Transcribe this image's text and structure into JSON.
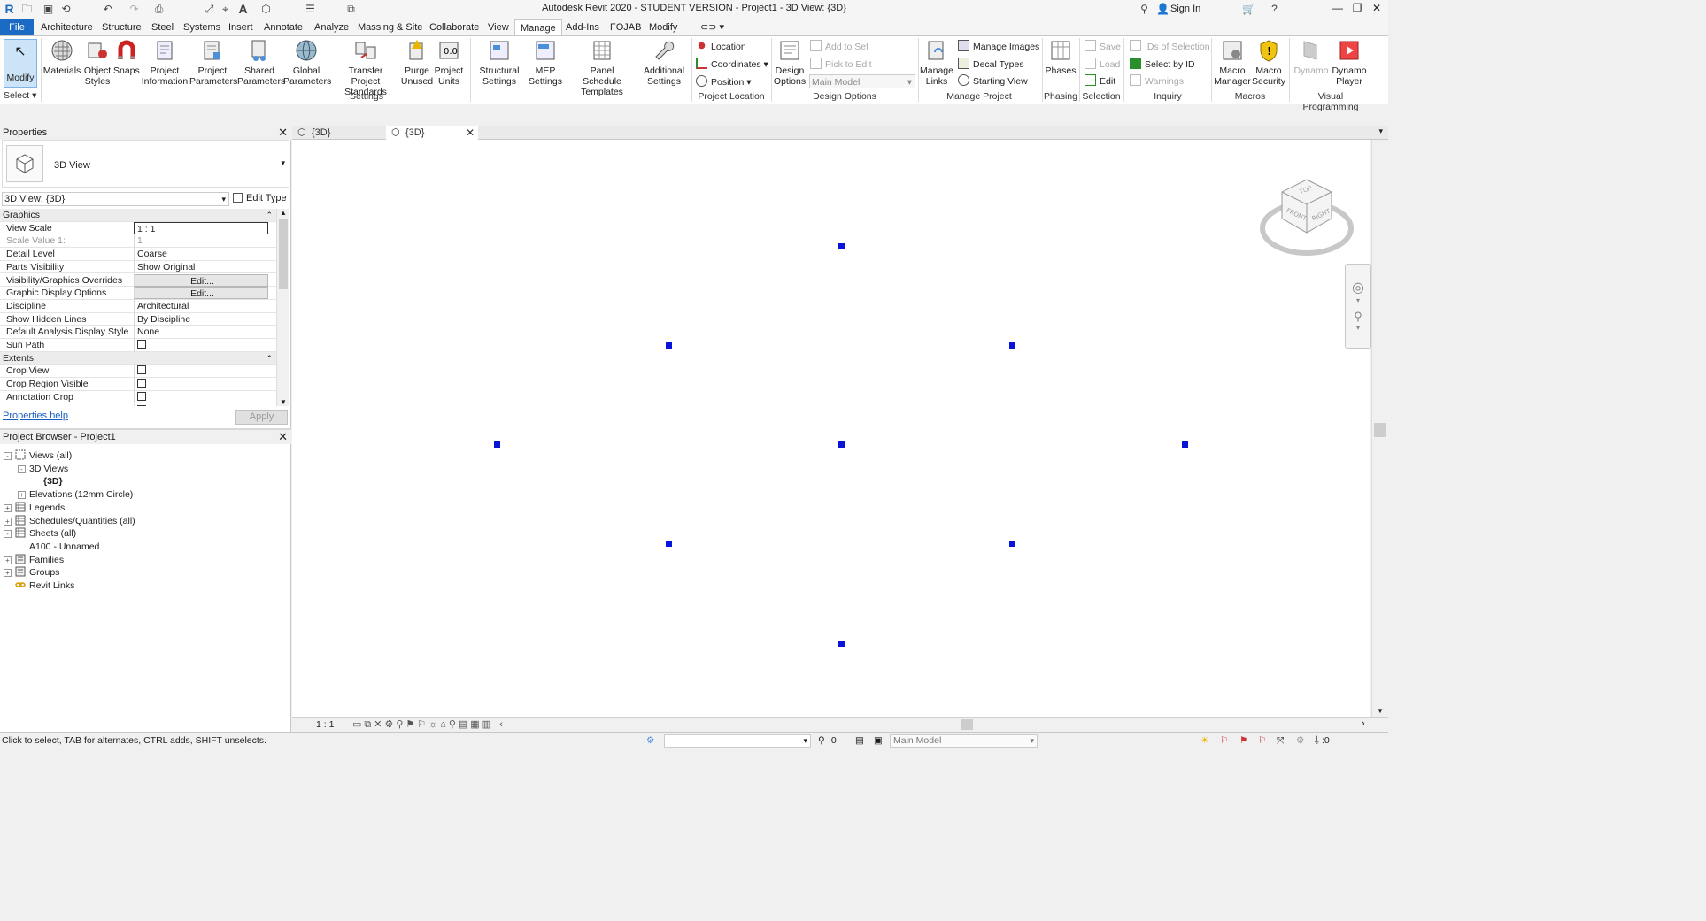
{
  "window": {
    "title": "Autodesk Revit 2020 - STUDENT VERSION - Project1 - 3D View: {3D}",
    "sign_in": "Sign In"
  },
  "ribbon_tabs": [
    "File",
    "Architecture",
    "Structure",
    "Steel",
    "Systems",
    "Insert",
    "Annotate",
    "Analyze",
    "Massing & Site",
    "Collaborate",
    "View",
    "Manage",
    "Add-Ins",
    "FOJAB",
    "Modify"
  ],
  "active_tab": "Manage",
  "ribbon": {
    "select_panel": {
      "modify": "Modify",
      "title": "Select"
    },
    "settings": {
      "title": "Settings",
      "buttons": [
        {
          "line1": "Materials",
          "line2": ""
        },
        {
          "line1": "Object",
          "line2": "Styles"
        },
        {
          "line1": "Snaps",
          "line2": ""
        },
        {
          "line1": "Project",
          "line2": "Information"
        },
        {
          "line1": "Project",
          "line2": "Parameters"
        },
        {
          "line1": "Shared",
          "line2": "Parameters"
        },
        {
          "line1": "Global",
          "line2": "Parameters"
        },
        {
          "line1": "Transfer",
          "line2": "Project Standards"
        },
        {
          "line1": "Purge",
          "line2": "Unused"
        },
        {
          "line1": "Project",
          "line2": "Units"
        },
        {
          "line1": "Structural",
          "line2": "Settings"
        },
        {
          "line1": "MEP",
          "line2": "Settings"
        },
        {
          "line1": "Panel Schedule",
          "line2": "Templates"
        },
        {
          "line1": "Additional",
          "line2": "Settings"
        }
      ]
    },
    "project_location": {
      "title": "Project Location",
      "location": "Location",
      "coordinates": "Coordinates",
      "position": "Position"
    },
    "design_options": {
      "title": "Design Options",
      "button_line1": "Design",
      "button_line2": "Options",
      "add_to_set": "Add to Set",
      "pick_to_edit": "Pick to Edit",
      "main_model": "Main Model"
    },
    "manage_project": {
      "title": "Manage Project",
      "links_line1": "Manage",
      "links_line2": "Links",
      "manage_images": "Manage  Images",
      "decal_types": "Decal  Types",
      "starting_view": "Starting  View"
    },
    "phasing": {
      "title": "Phasing",
      "phases": "Phases"
    },
    "selection": {
      "title": "Selection",
      "save": "Save",
      "load": "Load",
      "edit": "Edit"
    },
    "inquiry": {
      "title": "Inquiry",
      "ids": "IDs  of  Selection",
      "select_by_id": "Select  by ID",
      "warnings": "Warnings"
    },
    "macros": {
      "title": "Macros",
      "manager_line1": "Macro",
      "manager_line2": "Manager",
      "security_line1": "Macro",
      "security_line2": "Security"
    },
    "visual_programming": {
      "title": "Visual Programming",
      "dynamo": "Dynamo",
      "player_line1": "Dynamo",
      "player_line2": "Player"
    }
  },
  "properties": {
    "header": "Properties",
    "type_name": "3D View",
    "selector": "3D View: {3D}",
    "edit_type": "Edit Type",
    "rows": [
      {
        "kind": "section",
        "name": "Graphics"
      },
      {
        "kind": "text",
        "name": "View Scale",
        "value": "1 : 1"
      },
      {
        "kind": "text",
        "name": "Scale Value    1:",
        "value": "1",
        "dim": true
      },
      {
        "kind": "text",
        "name": "Detail Level",
        "value": "Coarse"
      },
      {
        "kind": "text",
        "name": "Parts Visibility",
        "value": "Show Original"
      },
      {
        "kind": "button",
        "name": "Visibility/Graphics Overrides",
        "value": "Edit..."
      },
      {
        "kind": "button",
        "name": "Graphic Display Options",
        "value": "Edit..."
      },
      {
        "kind": "text",
        "name": "Discipline",
        "value": "Architectural"
      },
      {
        "kind": "text",
        "name": "Show Hidden Lines",
        "value": "By Discipline"
      },
      {
        "kind": "text",
        "name": "Default Analysis Display Style",
        "value": "None"
      },
      {
        "kind": "check",
        "name": "Sun Path",
        "value": ""
      },
      {
        "kind": "section",
        "name": "Extents"
      },
      {
        "kind": "check",
        "name": "Crop View",
        "value": ""
      },
      {
        "kind": "check",
        "name": "Crop Region Visible",
        "value": ""
      },
      {
        "kind": "check",
        "name": "Annotation Crop",
        "value": ""
      },
      {
        "kind": "check",
        "name": "Far Clip Active",
        "value": ""
      }
    ],
    "help": "Properties help",
    "apply": "Apply"
  },
  "browser": {
    "header": "Project Browser - Project1",
    "items": [
      {
        "label": "Views (all)",
        "indent": 0,
        "box": "-",
        "icon": "views"
      },
      {
        "label": "3D Views",
        "indent": 1,
        "box": "-",
        "icon": ""
      },
      {
        "label": "{3D}",
        "indent": 2,
        "box": "",
        "icon": "",
        "bold": true
      },
      {
        "label": "Elevations (12mm Circle)",
        "indent": 1,
        "box": "+",
        "icon": ""
      },
      {
        "label": "Legends",
        "indent": 0,
        "box": "+",
        "icon": "grid"
      },
      {
        "label": "Schedules/Quantities (all)",
        "indent": 0,
        "box": "+",
        "icon": "grid"
      },
      {
        "label": "Sheets (all)",
        "indent": 0,
        "box": "-",
        "icon": "grid"
      },
      {
        "label": "A100 - Unnamed",
        "indent": 1,
        "box": "",
        "icon": ""
      },
      {
        "label": "Families",
        "indent": 0,
        "box": "+",
        "icon": "fam"
      },
      {
        "label": "Groups",
        "indent": 0,
        "box": "+",
        "icon": "fam"
      },
      {
        "label": "Revit Links",
        "indent": 0,
        "box": "",
        "icon": "link"
      }
    ]
  },
  "view_tabs": [
    {
      "label": "{3D}",
      "active": false
    },
    {
      "label": "{3D}",
      "active": true
    }
  ],
  "viewcube": {
    "top": "TOP",
    "front": "FRONT",
    "right": "RIGHT"
  },
  "view_control": {
    "scale": "1 : 1"
  },
  "status": {
    "message": "Click to select, TAB for alternates, CTRL adds, SHIFT unselects.",
    "count_a": ":0",
    "main_model": "Main Model",
    "count_b": ":0"
  },
  "colors": {
    "accent": "#1b6bc4",
    "dot": "#0a14d9"
  }
}
